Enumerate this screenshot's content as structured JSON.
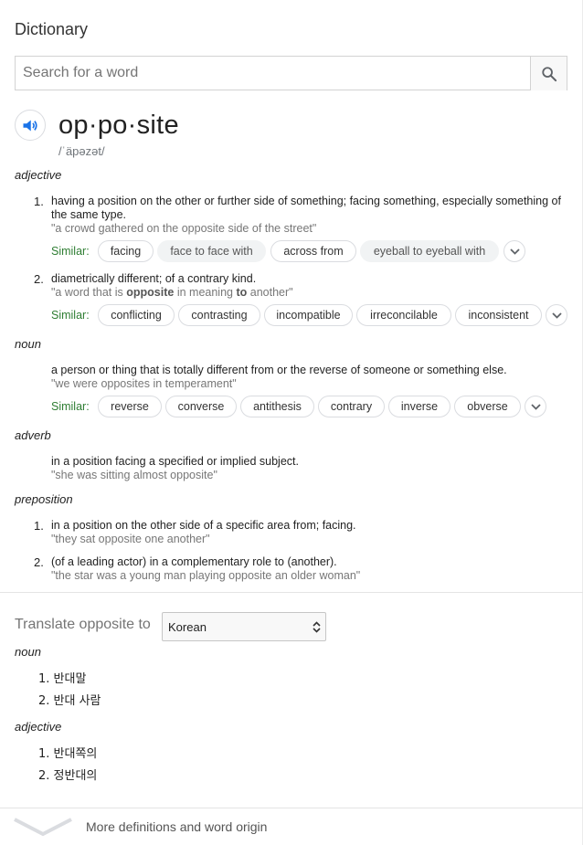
{
  "header": {
    "title": "Dictionary"
  },
  "search": {
    "placeholder": "Search for a word",
    "value": ""
  },
  "entry": {
    "headword": "op·po·site",
    "phonetic": "/ˈäpəzət/"
  },
  "senses": {
    "adjective": {
      "label": "adjective",
      "defs": [
        {
          "num": "1.",
          "text": "having a position on the other or further side of something; facing something, especially something of the same type.",
          "example": "\"a crowd gathered on the opposite side of the street\"",
          "similar_label": "Similar:",
          "similar": [
            "facing",
            "face to face with",
            "across from",
            "eyeball to eyeball with"
          ]
        },
        {
          "num": "2.",
          "text": "diametrically different; of a contrary kind.",
          "example_pre": "\"a word that is ",
          "example_bold1": "opposite",
          "example_mid": " in meaning ",
          "example_bold2": "to",
          "example_post": " another\"",
          "similar_label": "Similar:",
          "similar": [
            "conflicting",
            "contrasting",
            "incompatible",
            "irreconcilable",
            "inconsistent"
          ]
        }
      ]
    },
    "noun": {
      "label": "noun",
      "defs": [
        {
          "text": "a person or thing that is totally different from or the reverse of someone or something else.",
          "example": "\"we were opposites in temperament\"",
          "similar_label": "Similar:",
          "similar": [
            "reverse",
            "converse",
            "antithesis",
            "contrary",
            "inverse",
            "obverse"
          ]
        }
      ]
    },
    "adverb": {
      "label": "adverb",
      "defs": [
        {
          "text": "in a position facing a specified or implied subject.",
          "example": "\"she was sitting almost opposite\""
        }
      ]
    },
    "preposition": {
      "label": "preposition",
      "defs": [
        {
          "num": "1.",
          "text": "in a position on the other side of a specific area from; facing.",
          "example": "\"they sat opposite one another\""
        },
        {
          "num": "2.",
          "text": "(of a leading actor) in a complementary role to (another).",
          "example": "\"the star was a young man playing opposite an older woman\""
        }
      ]
    }
  },
  "translate": {
    "label": "Translate opposite to",
    "language": "Korean",
    "groups": [
      {
        "pos": "noun",
        "items": [
          "1. 반대말",
          "2. 반대 사람"
        ]
      },
      {
        "pos": "adjective",
        "items": [
          "1. 반대쪽의",
          "2. 정반대의"
        ]
      }
    ]
  },
  "footer": {
    "more_label": "More definitions and word origin"
  },
  "icons": {
    "search": "search-icon",
    "speaker": "speaker-icon",
    "expand": "chevron-down-icon",
    "select": "select-arrows-icon",
    "more": "chevron-down-icon"
  },
  "colors": {
    "similar_green": "#2e7d32",
    "speaker_blue": "#1a73e8",
    "example_grey": "#777777"
  }
}
